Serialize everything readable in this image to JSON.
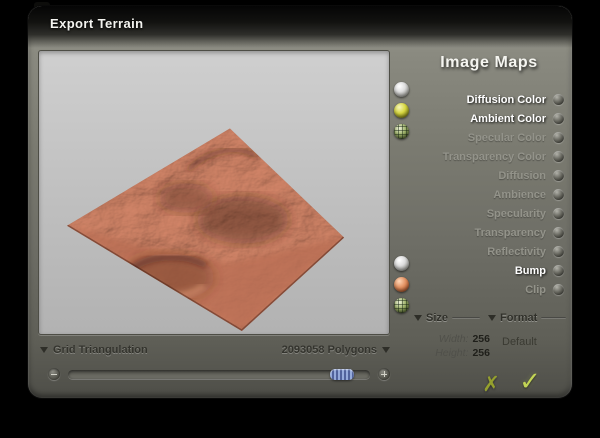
{
  "window": {
    "title": "Export Terrain"
  },
  "preview": {
    "description": "3D terrain render preview"
  },
  "material_spheres": {
    "top": [
      "white",
      "yellow",
      "wire"
    ],
    "bottom": [
      "white",
      "orange",
      "wire"
    ]
  },
  "image_maps": {
    "title": "Image Maps",
    "items": [
      {
        "label": "Diffusion Color",
        "active": true
      },
      {
        "label": "Ambient Color",
        "active": true
      },
      {
        "label": "Specular Color",
        "active": false
      },
      {
        "label": "Transparency Color",
        "active": false
      },
      {
        "label": "Diffusion",
        "active": false
      },
      {
        "label": "Ambience",
        "active": false
      },
      {
        "label": "Specularity",
        "active": false
      },
      {
        "label": "Transparency",
        "active": false
      },
      {
        "label": "Reflectivity",
        "active": false
      },
      {
        "label": "Bump",
        "active": true
      },
      {
        "label": "Clip",
        "active": false
      }
    ]
  },
  "size_section": {
    "title": "Size",
    "fields": [
      {
        "label": "Width:",
        "value": "256"
      },
      {
        "label": "Height:",
        "value": "256"
      }
    ]
  },
  "format_section": {
    "title": "Format",
    "value": "Default"
  },
  "footer": {
    "triangulation": "Grid Triangulation",
    "polygons": "2093058 Polygons"
  },
  "slider": {
    "position": 0.95
  },
  "actions": {
    "cancel": "✗",
    "confirm": "✓"
  },
  "colors": {
    "accent_green": "#c2d455",
    "accent_olive": "#95a02e",
    "terrain": "#b5674d",
    "handle_blue": "#6d83bd"
  }
}
